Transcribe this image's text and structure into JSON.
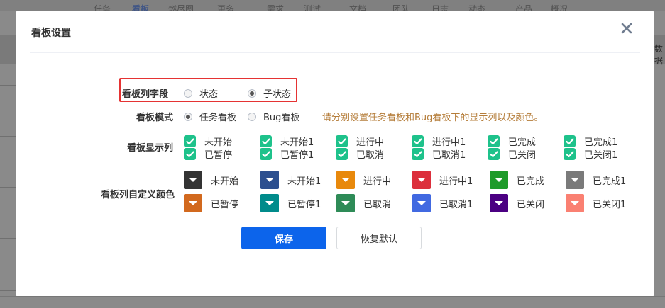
{
  "background": {
    "nav_items": [
      "任务",
      "看板",
      "燃尽图",
      "更多",
      "需求",
      "测试",
      "文档",
      "团队",
      "日志",
      "动态",
      "产品",
      "概况"
    ],
    "right_text": "数据"
  },
  "modal": {
    "title": "看板设置",
    "close_icon": "close-icon"
  },
  "column_field": {
    "label": "看板列字段",
    "options": [
      "状态",
      "子状态"
    ],
    "selected": "子状态"
  },
  "kanban_mode": {
    "label": "看板模式",
    "options": [
      "任务看板",
      "Bug看板"
    ],
    "selected": "任务看板",
    "hint": "请分别设置任务看板和Bug看板下的显示列以及颜色。"
  },
  "display_columns": {
    "label": "看板显示列",
    "items": [
      "未开始",
      "未开始1",
      "进行中",
      "进行中1",
      "已完成",
      "已完成1",
      "已暂停",
      "已暂停1",
      "已取消",
      "已取消1",
      "已关闭",
      "已关闭1"
    ],
    "check_color": "#1ec28b"
  },
  "column_colors": {
    "label": "看板列自定义颜色",
    "items": [
      {
        "name": "未开始",
        "color": "#333333"
      },
      {
        "name": "未开始1",
        "color": "#2c4f8f"
      },
      {
        "name": "进行中",
        "color": "#e8890c"
      },
      {
        "name": "进行中1",
        "color": "#dc2f3c"
      },
      {
        "name": "已完成",
        "color": "#1e9b2a"
      },
      {
        "name": "已完成1",
        "color": "#7a7a7a"
      },
      {
        "name": "已暂停",
        "color": "#d2691e"
      },
      {
        "name": "已暂停1",
        "color": "#008b8b"
      },
      {
        "name": "已取消",
        "color": "#2e8b57"
      },
      {
        "name": "已取消1",
        "color": "#4169e1"
      },
      {
        "name": "已关闭",
        "color": "#4b0082"
      },
      {
        "name": "已关闭1",
        "color": "#fa8072"
      }
    ]
  },
  "buttons": {
    "save": "保存",
    "reset": "恢复默认"
  },
  "colors": {
    "primary": "#0c64eb",
    "highlight_border": "#e53333",
    "hint": "#b57d3a"
  }
}
